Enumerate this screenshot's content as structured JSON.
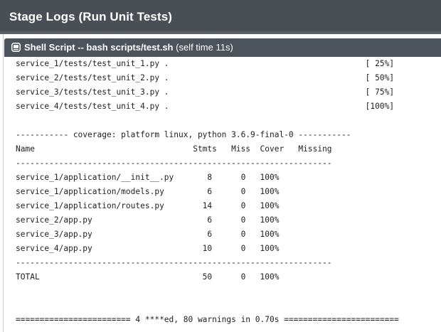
{
  "header": {
    "title": "Stage Logs (Run Unit Tests)"
  },
  "step": {
    "icon": "shell-terminal-icon",
    "label": "Shell Script -- bash scripts/test.sh",
    "self_time": "(self time 11s)"
  },
  "log": {
    "lines": [
      "service_1/tests/test_unit_1.py .                                         [ 25%]",
      "service_2/tests/test_unit_2.py .                                         [ 50%]",
      "service_3/tests/test_unit_3.py .                                         [ 75%]",
      "service_4/tests/test_unit_4.py .                                         [100%]",
      "",
      "----------- coverage: platform linux, python 3.6.9-final-0 -----------",
      "Name                                 Stmts   Miss  Cover   Missing",
      "------------------------------------------------------------------",
      "service_1/application/__init__.py       8      0   100%",
      "service_1/application/models.py         6      0   100%",
      "service_1/application/routes.py        14      0   100%",
      "service_2/app.py                        6      0   100%",
      "service_3/app.py                        6      0   100%",
      "service_4/app.py                       10      0   100%",
      "------------------------------------------------------------------",
      "TOTAL                                  50      0   100%",
      "",
      "",
      "======================== 4 ****ed, 80 warnings in 0.70s ========================"
    ]
  }
}
